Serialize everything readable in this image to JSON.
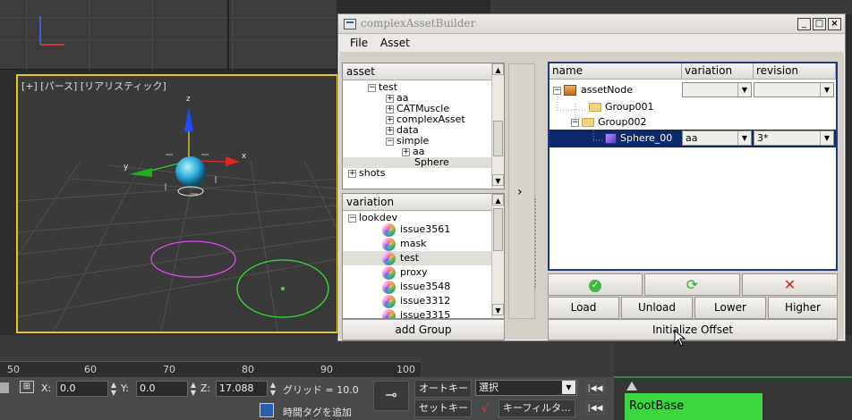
{
  "viewport": {
    "label": "[+] [パース] [リアリスティック]"
  },
  "timeline": {
    "ticks": [
      "50",
      "60",
      "70",
      "80",
      "90",
      "100"
    ]
  },
  "statusbar": {
    "x_label": "X:",
    "x_value": "0.0",
    "y_label": "Y:",
    "y_value": "0.0",
    "z_label": "Z:",
    "z_value": "17.088",
    "grid_text": "グリッド = 10.0",
    "autokey_label": "オートキー",
    "setkey_label": "セットキー",
    "selection_value": "選択",
    "keyfilter_label": "キーフィルタ...",
    "add_time_tag": "時間タグを追加"
  },
  "rootbase_label": "RootBase",
  "dialog": {
    "title": "complexAssetBuilder",
    "menu": [
      "File",
      "Asset"
    ],
    "asset_tree": {
      "header": "asset",
      "rows": [
        {
          "label": "test",
          "expander": "−"
        },
        {
          "label": "aa",
          "expander": "+"
        },
        {
          "label": "CATMuscle",
          "expander": "+"
        },
        {
          "label": "complexAsset",
          "expander": "+"
        },
        {
          "label": "data",
          "expander": "+"
        },
        {
          "label": "simple",
          "expander": "−"
        },
        {
          "label": "aa",
          "expander": "+"
        },
        {
          "label": "Sphere",
          "expander": ""
        },
        {
          "label": "shots",
          "expander": "+"
        }
      ]
    },
    "variation_list": {
      "header": "variation",
      "root": "lookdev",
      "items": [
        "issue3561",
        "mask",
        "test",
        "proxy",
        "issue3548",
        "issue3312",
        "issue3315"
      ]
    },
    "splitter_arrow": "›",
    "add_group_label": "add Group",
    "grid": {
      "headers": [
        "name",
        "variation",
        "revision"
      ],
      "rows": [
        {
          "name": "assetNode",
          "variation": "",
          "revision": ""
        },
        {
          "name": "Group001"
        },
        {
          "name": "Group002"
        },
        {
          "name": "Sphere_00",
          "variation": "aa",
          "revision": "3*"
        }
      ]
    },
    "icon_buttons": [
      "check-icon",
      "refresh-icon",
      "delete-icon"
    ],
    "action_buttons": [
      "Load",
      "Unload",
      "Lower",
      "Higher"
    ],
    "initialize_offset_label": "Initialize Offset"
  }
}
